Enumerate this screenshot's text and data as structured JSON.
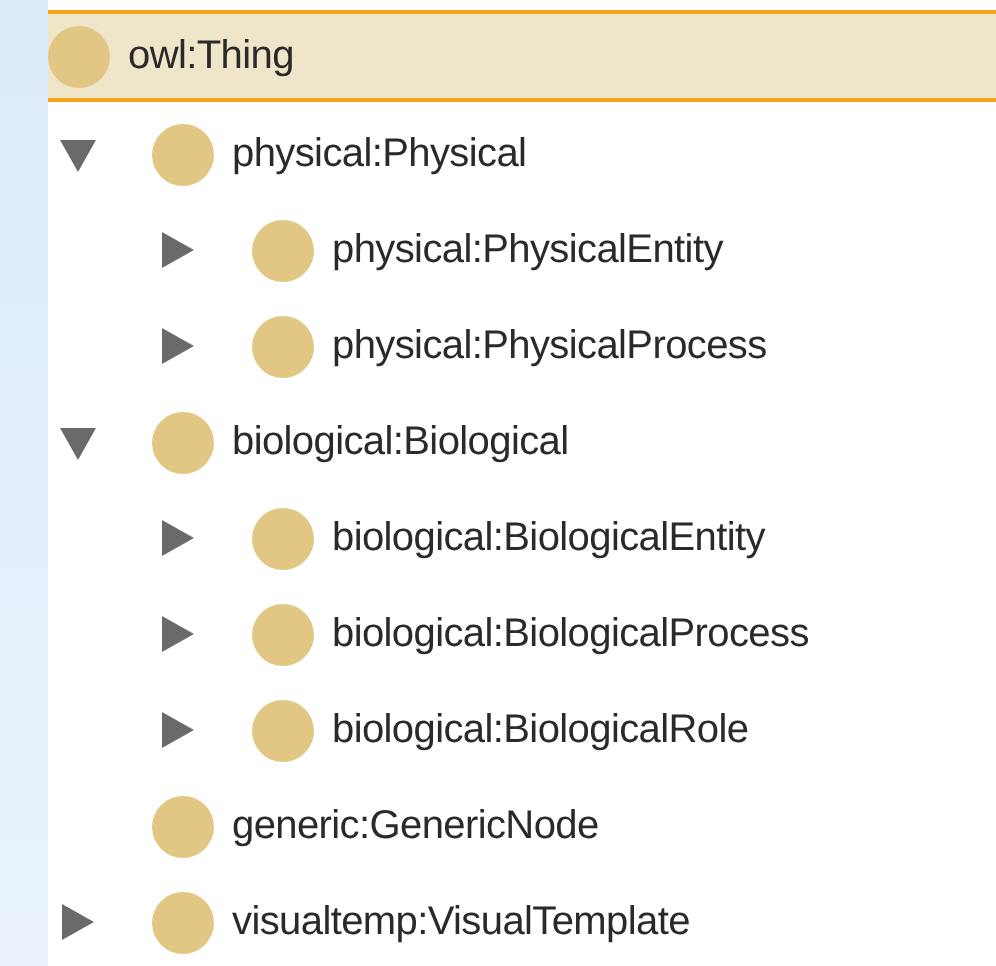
{
  "tree": {
    "label": "owl:Thing",
    "selected": true,
    "children": [
      {
        "label": "physical:Physical",
        "selected": false,
        "kind": "branch",
        "expanded": true,
        "children": [
          {
            "label": "physical:PhysicalEntity",
            "selected": false,
            "kind": "branch",
            "expanded": false
          },
          {
            "label": "physical:PhysicalProcess",
            "selected": false,
            "kind": "branch",
            "expanded": false
          }
        ]
      },
      {
        "label": "biological:Biological",
        "selected": false,
        "kind": "branch",
        "expanded": true,
        "children": [
          {
            "label": "biological:BiologicalEntity",
            "selected": false,
            "kind": "branch",
            "expanded": false
          },
          {
            "label": "biological:BiologicalProcess",
            "selected": false,
            "kind": "branch",
            "expanded": false
          },
          {
            "label": "biological:BiologicalRole",
            "selected": false,
            "kind": "branch",
            "expanded": false
          }
        ]
      },
      {
        "label": "generic:GenericNode",
        "selected": false,
        "kind": "leaf"
      },
      {
        "label": "visualtemp:VisualTemplate",
        "selected": false,
        "kind": "branch",
        "expanded": false
      }
    ]
  }
}
